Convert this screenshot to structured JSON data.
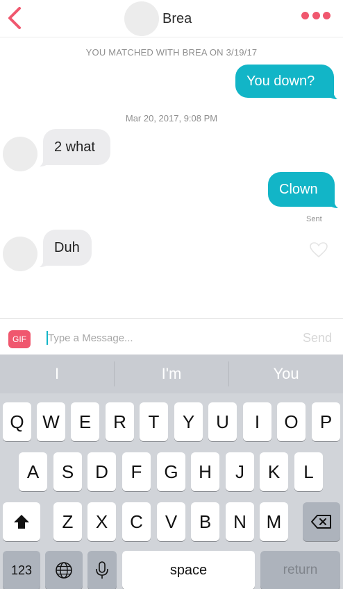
{
  "header": {
    "title": "Brea",
    "back_icon": "chevron-left-icon",
    "more_icon": "more-dots-icon",
    "accent_color": "#f0576e"
  },
  "chat": {
    "matched_text": "YOU MATCHED WITH BREA ON 3/19/17",
    "timestamp": "Mar 20, 2017, 9:08 PM",
    "messages": [
      {
        "direction": "outgoing",
        "text": "You down?"
      },
      {
        "direction": "incoming",
        "text": "2 what"
      },
      {
        "direction": "outgoing",
        "text": "Clown"
      },
      {
        "direction": "incoming",
        "text": "Duh"
      }
    ],
    "sent_label": "Sent",
    "outgoing_color": "#12b5c7",
    "incoming_color": "#ececee",
    "like_icon": "heart-outline-icon"
  },
  "composer": {
    "gif_label": "GIF",
    "placeholder": "Type a Message...",
    "value": "",
    "send_label": "Send"
  },
  "keyboard": {
    "suggestions": [
      "I",
      "I'm",
      "You"
    ],
    "row1": [
      "Q",
      "W",
      "E",
      "R",
      "T",
      "Y",
      "U",
      "I",
      "O",
      "P"
    ],
    "row2": [
      "A",
      "S",
      "D",
      "F",
      "G",
      "H",
      "J",
      "K",
      "L"
    ],
    "row3": [
      "Z",
      "X",
      "C",
      "V",
      "B",
      "N",
      "M"
    ],
    "shift_icon": "shift-arrow-icon",
    "backspace_icon": "backspace-icon",
    "numbers_label": "123",
    "globe_icon": "globe-icon",
    "mic_icon": "microphone-icon",
    "space_label": "space",
    "return_label": "return"
  }
}
